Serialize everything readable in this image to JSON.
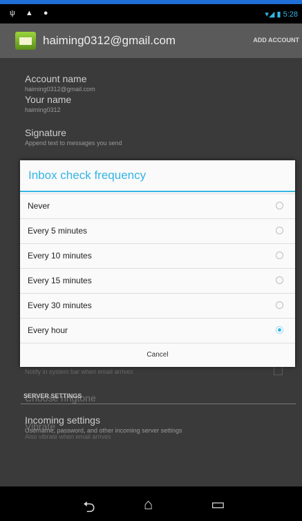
{
  "statusbar": {
    "left_icons": "ψ ▲ ●",
    "time": "5:28"
  },
  "actionbar": {
    "account": "haiming0312@gmail.com",
    "add_account": "ADD ACCOUNT"
  },
  "settings": {
    "account_name": {
      "title": "Account name",
      "summary": "haiming0312@gmail.com"
    },
    "your_name": {
      "title": "Your name",
      "summary": "haiming0312"
    },
    "signature": {
      "title": "Signature",
      "summary": "Append text to messages you send"
    },
    "notify": {
      "summary": "Notify in system bar when email arrives"
    },
    "ringtone": {
      "title": "Choose ringtone"
    },
    "vibrate": {
      "title": "Vibrate",
      "summary": "Also vibrate when email arrives"
    },
    "section_server": "SERVER SETTINGS",
    "incoming": {
      "title": "Incoming settings",
      "summary": "Username, password, and other incoming server settings"
    }
  },
  "dialog": {
    "title": "Inbox check frequency",
    "options": [
      {
        "label": "Never",
        "checked": false
      },
      {
        "label": "Every 5 minutes",
        "checked": false
      },
      {
        "label": "Every 10 minutes",
        "checked": false
      },
      {
        "label": "Every 15 minutes",
        "checked": false
      },
      {
        "label": "Every 30 minutes",
        "checked": false
      },
      {
        "label": "Every hour",
        "checked": true
      }
    ],
    "cancel": "Cancel"
  },
  "navbar": {
    "back": "⮌",
    "home": "⌂",
    "recents": "▭"
  },
  "colors": {
    "accent": "#33b5e5",
    "background": "#3a3a3a"
  }
}
